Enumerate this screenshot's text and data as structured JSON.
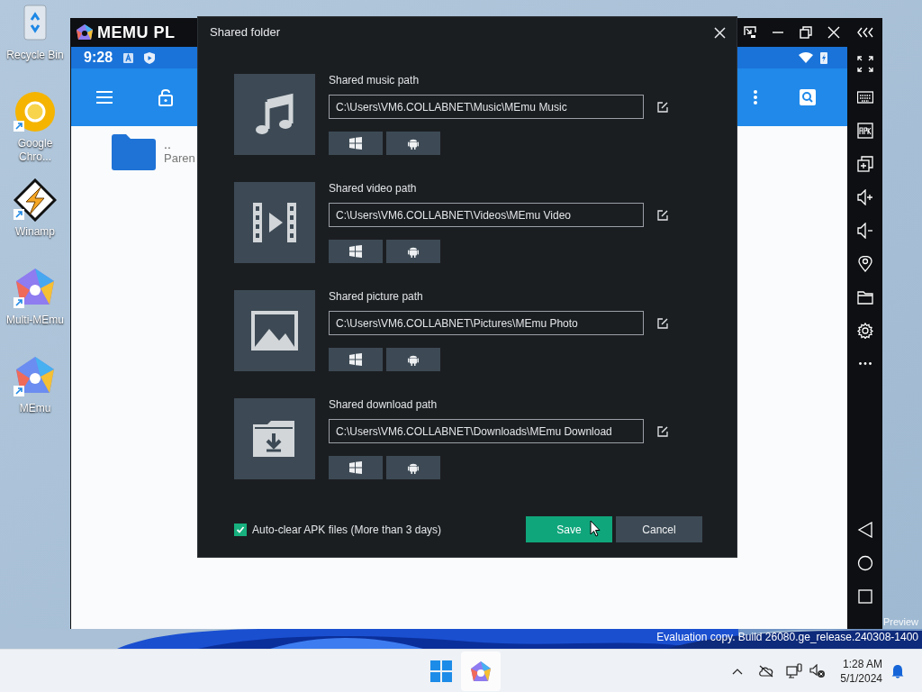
{
  "desktop_icons": [
    {
      "kind": "recycle",
      "label": "Recycle Bin"
    },
    {
      "kind": "ring",
      "label": "Google Chro..."
    },
    {
      "kind": "bolt",
      "label": "Winamp"
    },
    {
      "kind": "multi",
      "label": "Multi-MEmu"
    },
    {
      "kind": "memu",
      "label": "MEmu"
    }
  ],
  "emulator": {
    "logo": "MEMU PL",
    "status_bar": {
      "time": "9:28"
    },
    "file_list": [
      {
        "name": "..",
        "detail": "Paren"
      }
    ]
  },
  "dialog": {
    "title": "Shared folder",
    "sections": [
      {
        "kind": "music",
        "label": "Shared music path",
        "value": "C:\\Users\\VM6.COLLABNET\\Music\\MEmu Music"
      },
      {
        "kind": "video",
        "label": "Shared video path",
        "value": "C:\\Users\\VM6.COLLABNET\\Videos\\MEmu Video"
      },
      {
        "kind": "picture",
        "label": "Shared picture path",
        "value": "C:\\Users\\VM6.COLLABNET\\Pictures\\MEmu Photo"
      },
      {
        "kind": "download",
        "label": "Shared download path",
        "value": "C:\\Users\\VM6.COLLABNET\\Downloads\\MEmu Download"
      }
    ],
    "auto_clear": {
      "label": "Auto-clear APK files (More than 3 days)",
      "checked": true
    },
    "buttons": [
      {
        "kind": "primary",
        "label": "Save"
      },
      {
        "kind": "secondary",
        "label": "Cancel"
      }
    ]
  },
  "system_notice": {
    "edition": "Preview",
    "build": "Evaluation copy. Build 26080.ge_release.240308-1400"
  },
  "taskbar": {
    "apps": [
      {
        "kind": "start",
        "selected": false
      },
      {
        "kind": "memu",
        "selected": true
      }
    ],
    "clock": {
      "time": "1:28 AM",
      "date": "5/1/2024"
    }
  }
}
